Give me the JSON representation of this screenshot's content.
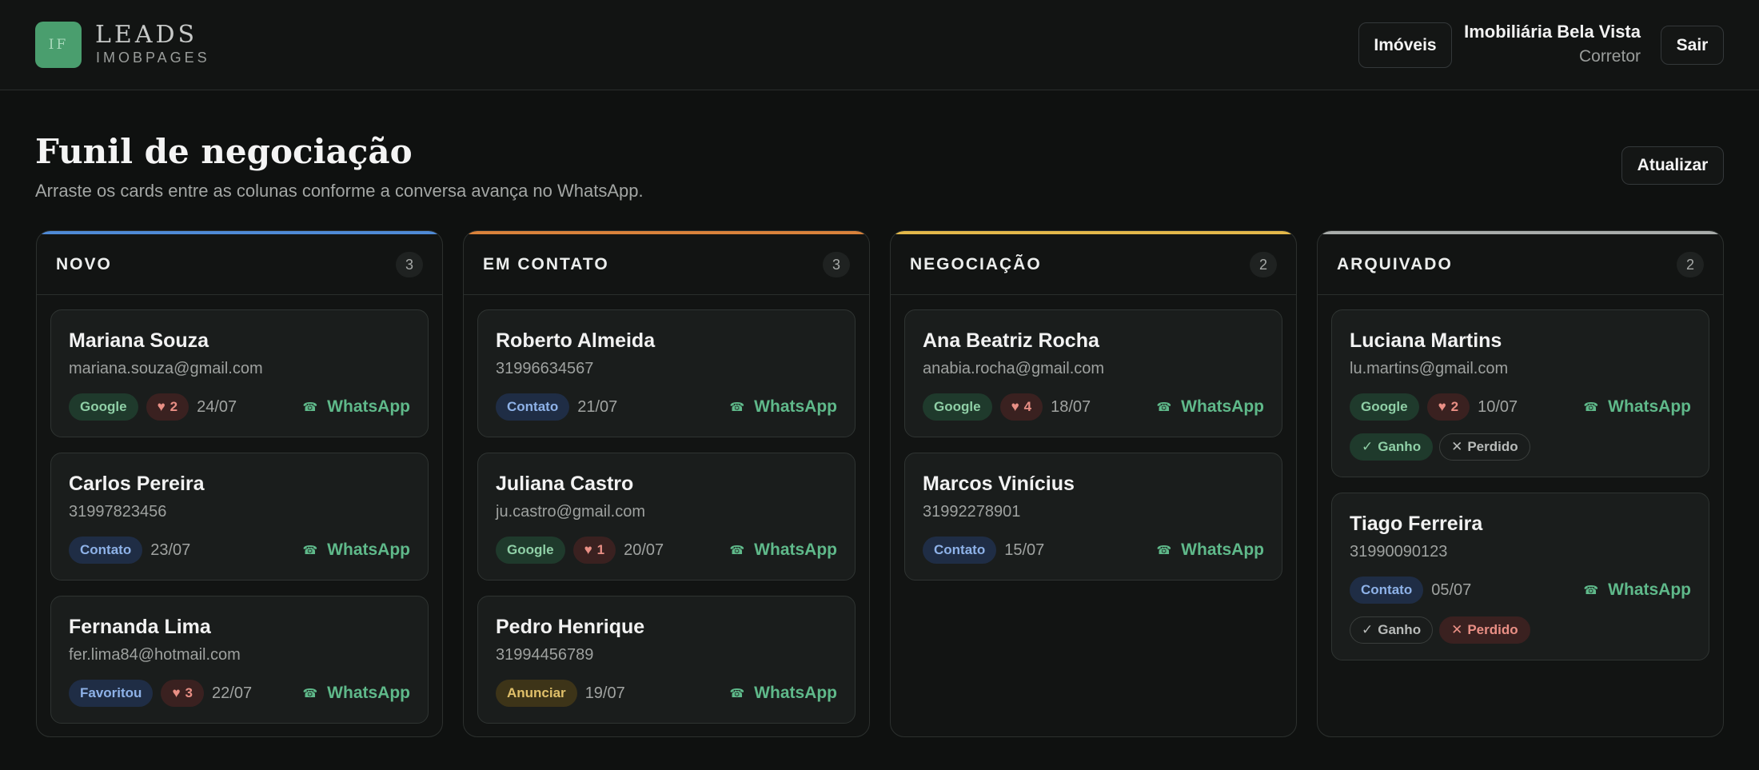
{
  "header": {
    "logo_text": "IF",
    "brand_title": "LEADS",
    "brand_subtitle": "IMOBPAGES",
    "imoveis_label": "Imóveis",
    "user_name": "Imobiliária Bela Vista",
    "user_role": "Corretor",
    "logout_label": "Sair"
  },
  "page": {
    "title": "Funil de negociação",
    "subtitle": "Arraste os cards entre as colunas conforme a conversa avança no WhatsApp.",
    "refresh_label": "Atualizar"
  },
  "whatsapp_label": "WhatsApp",
  "outcome_labels": {
    "ganho": "Ganho",
    "perdido": "Perdido"
  },
  "colors": {
    "novo": "#4f8ad6",
    "em_contato": "#d9823b",
    "negociacao": "#e3b84a",
    "arquivado": "#a9adab",
    "whatsapp": "#5fb98a"
  },
  "columns": [
    {
      "title": "NOVO",
      "count": "3",
      "cards": [
        {
          "name": "Mariana Souza",
          "contact": "mariana.souza@gmail.com",
          "source": "Google",
          "likes": "2",
          "date": "24/07"
        },
        {
          "name": "Carlos Pereira",
          "contact": "31997823456",
          "source": "Contato",
          "date": "23/07"
        },
        {
          "name": "Fernanda Lima",
          "contact": "fer.lima84@hotmail.com",
          "source": "Favoritou",
          "likes": "3",
          "date": "22/07"
        }
      ]
    },
    {
      "title": "EM CONTATO",
      "count": "3",
      "cards": [
        {
          "name": "Roberto Almeida",
          "contact": "31996634567",
          "source": "Contato",
          "date": "21/07"
        },
        {
          "name": "Juliana Castro",
          "contact": "ju.castro@gmail.com",
          "source": "Google",
          "likes": "1",
          "date": "20/07"
        },
        {
          "name": "Pedro Henrique",
          "contact": "31994456789",
          "source": "Anunciar",
          "date": "19/07"
        }
      ]
    },
    {
      "title": "NEGOCIAÇÃO",
      "count": "2",
      "cards": [
        {
          "name": "Ana Beatriz Rocha",
          "contact": "anabia.rocha@gmail.com",
          "source": "Google",
          "likes": "4",
          "date": "18/07"
        },
        {
          "name": "Marcos Vinícius",
          "contact": "31992278901",
          "source": "Contato",
          "date": "15/07"
        }
      ]
    },
    {
      "title": "ARQUIVADO",
      "count": "2",
      "cards": [
        {
          "name": "Luciana Martins",
          "contact": "lu.martins@gmail.com",
          "source": "Google",
          "likes": "2",
          "date": "10/07",
          "outcome": "Ganho"
        },
        {
          "name": "Tiago Ferreira",
          "contact": "31990090123",
          "source": "Contato",
          "date": "05/07",
          "outcome": "Perdido"
        }
      ]
    }
  ]
}
